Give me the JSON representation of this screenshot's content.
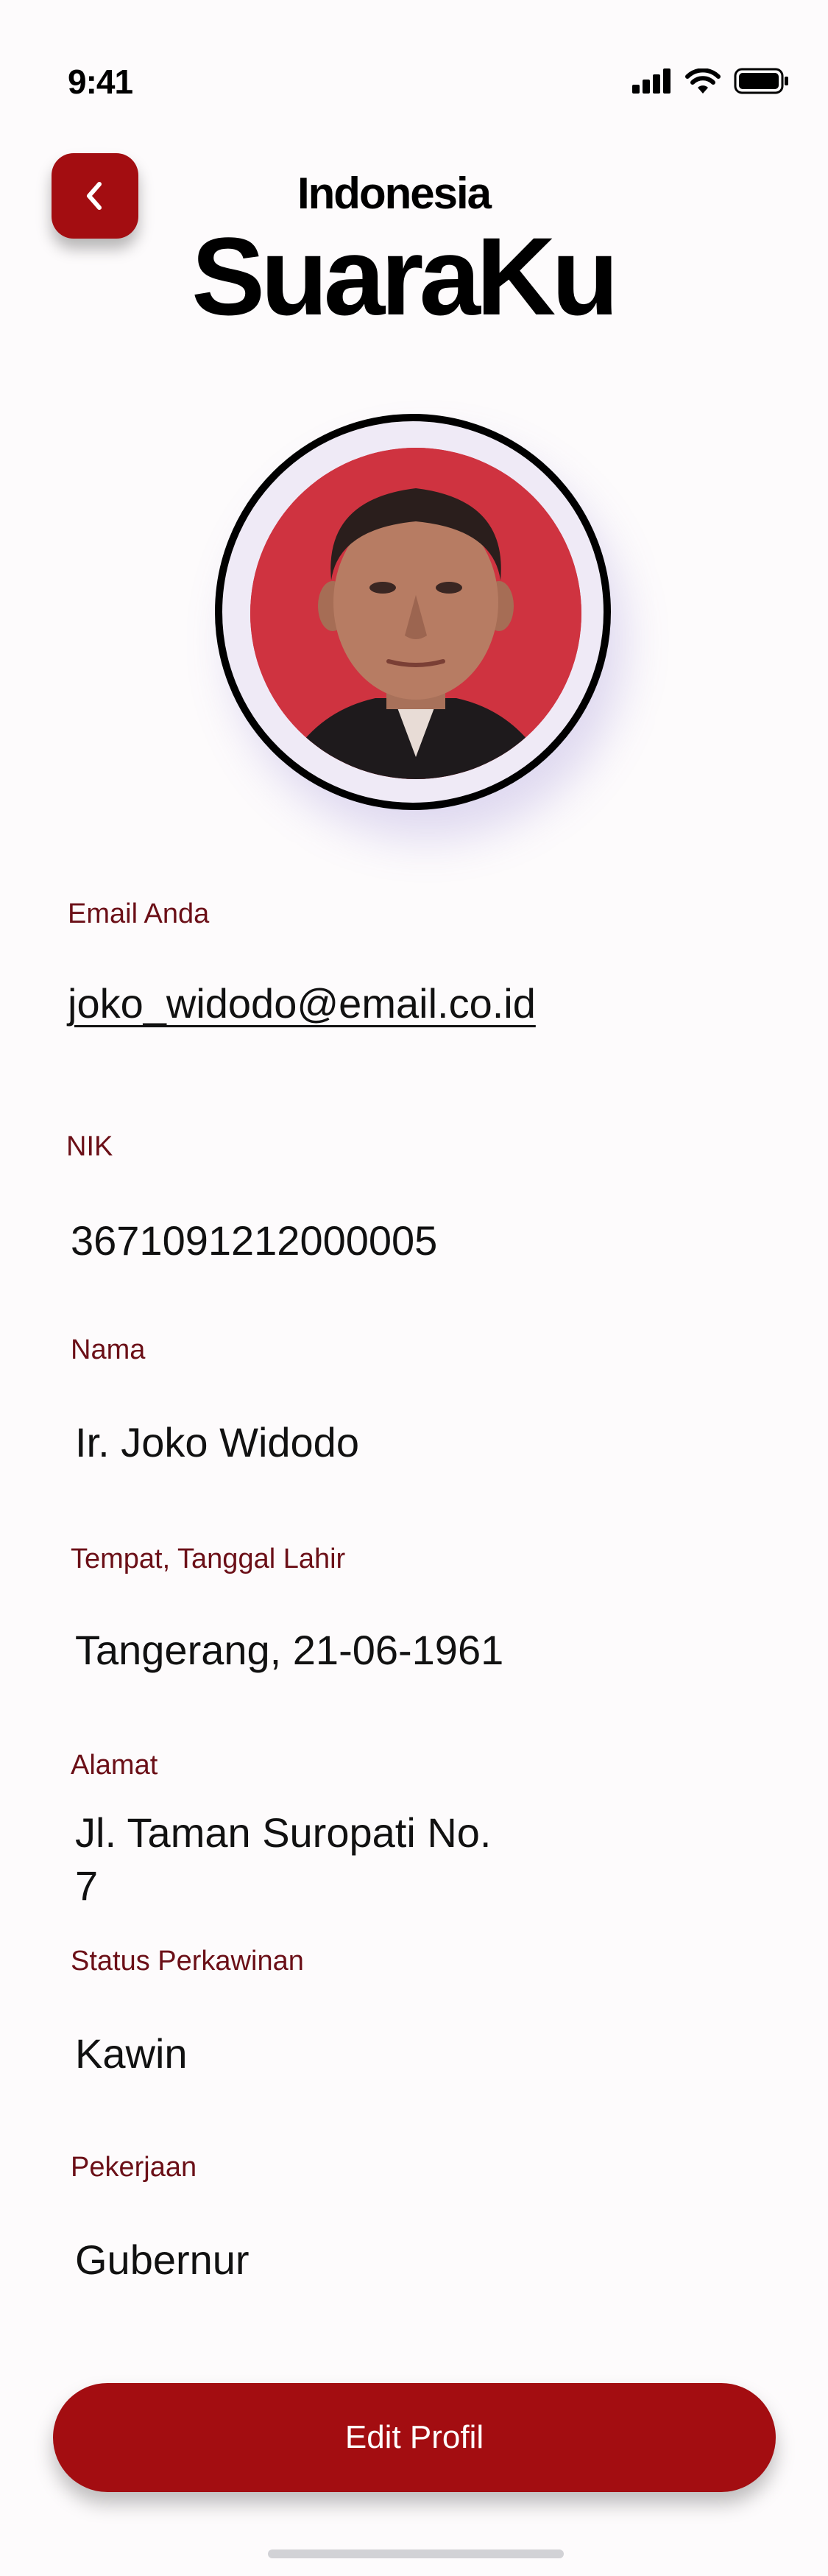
{
  "status_bar": {
    "time": "9:41"
  },
  "header": {
    "subtitle": "Indonesia",
    "title": "SuaraKu"
  },
  "profile": {
    "email_label": "Email Anda",
    "email": "joko_widodo@email.co.id",
    "nik_label": "NIK",
    "nik": "3671091212000005",
    "name_label": "Nama",
    "name": "Ir. Joko Widodo",
    "birth_label": "Tempat, Tanggal Lahir",
    "birth": "Tangerang, 21-06-1961",
    "address_label": "Alamat",
    "address_line1": "Jl. Taman Suropati No.",
    "address_line2": "7",
    "marital_label": "Status Perkawinan",
    "marital": "Kawin",
    "job_label": "Pekerjaan",
    "job": "Gubernur"
  },
  "actions": {
    "edit_label": "Edit Profil"
  },
  "colors": {
    "primary": "#a30d11",
    "label": "#6b0f17",
    "photo_background": "#cf3340"
  },
  "icons": [
    "cellular-signal-icon",
    "wifi-icon",
    "battery-icon",
    "chevron-left-icon"
  ]
}
